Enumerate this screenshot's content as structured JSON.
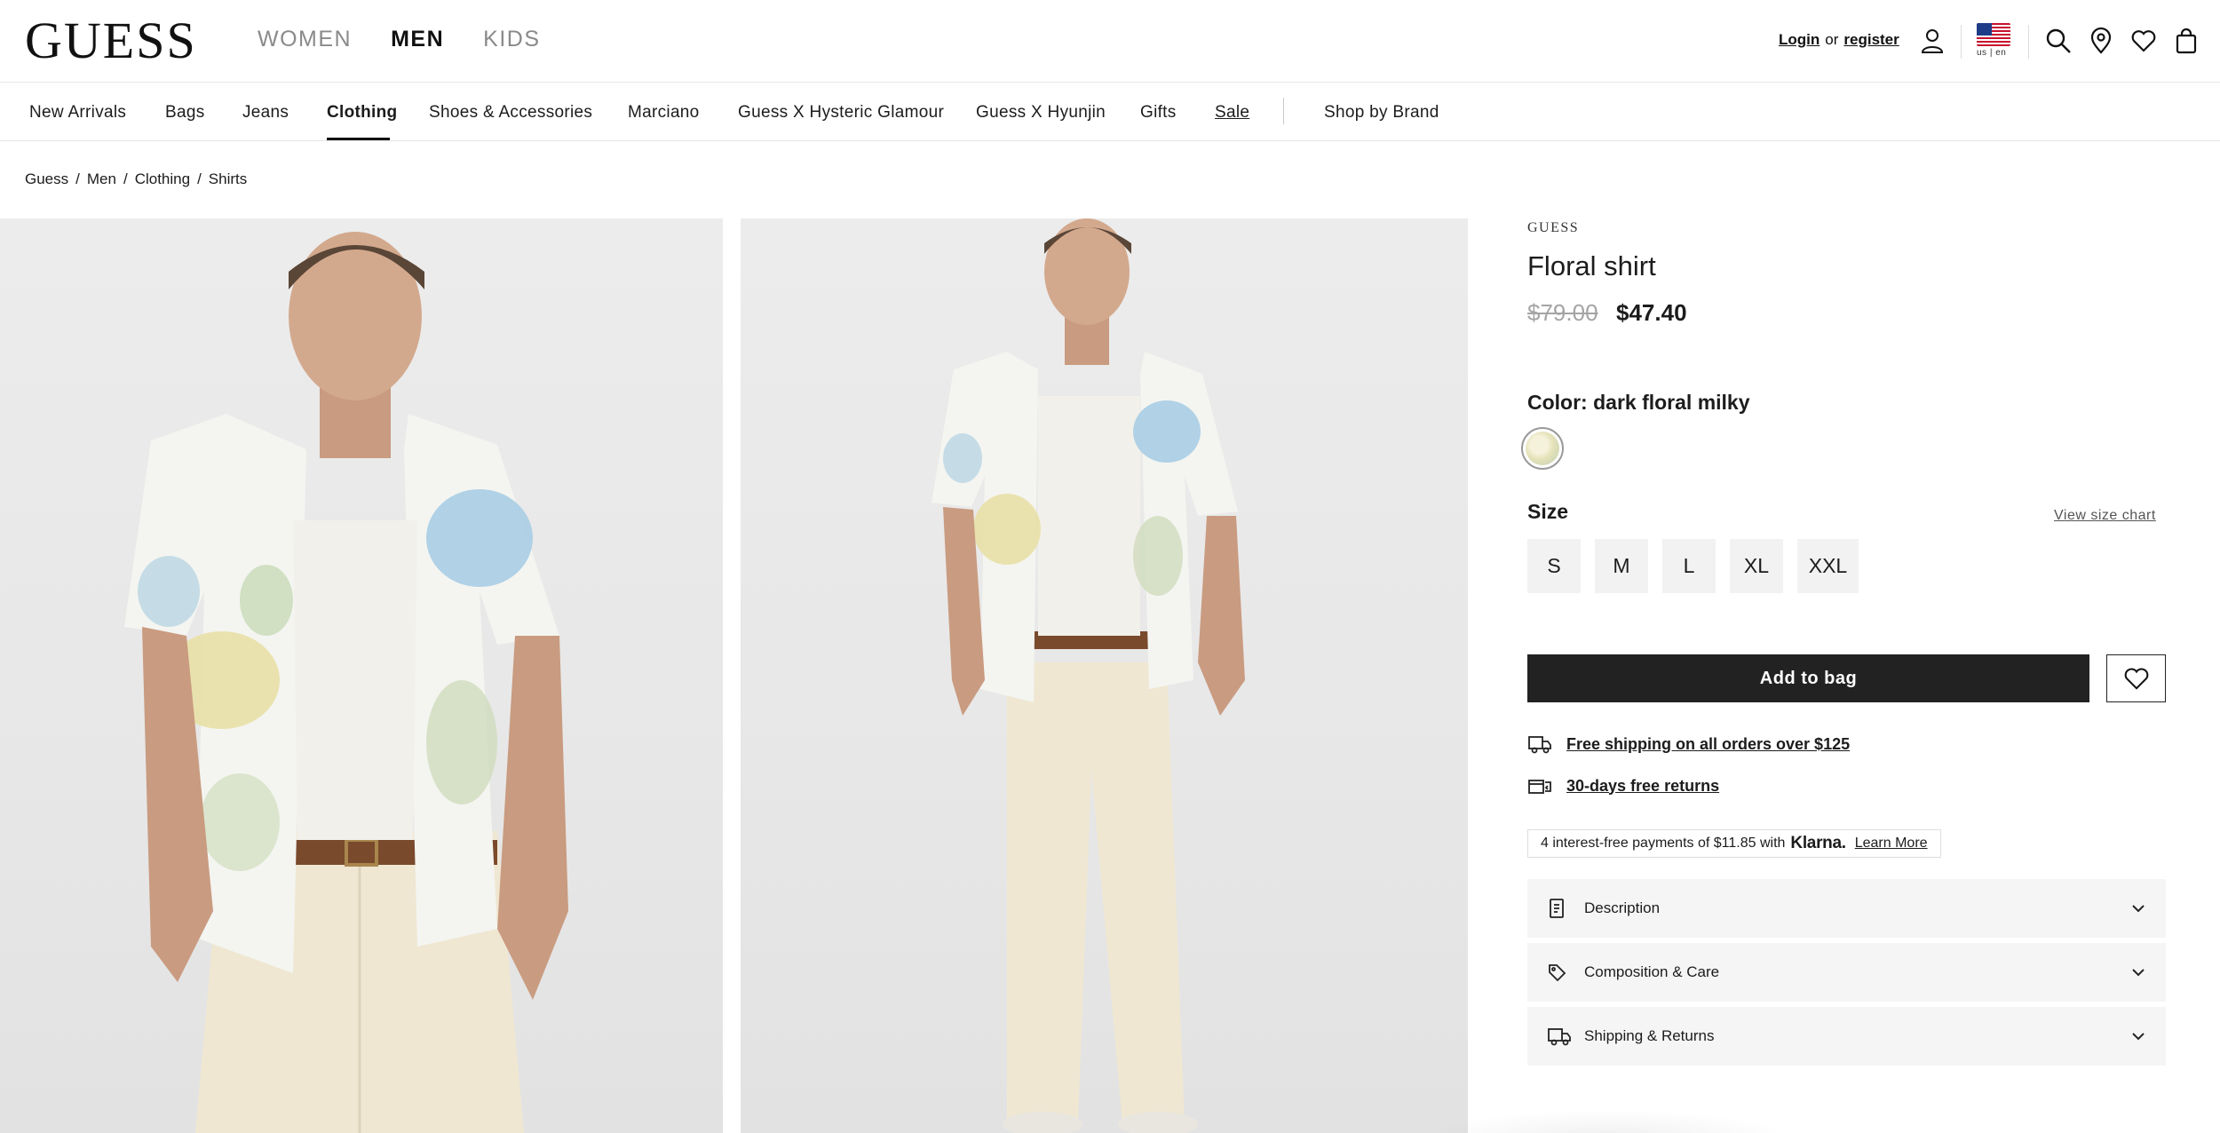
{
  "header": {
    "logo": "GUESS",
    "gender_tabs": [
      {
        "label": "WOMEN",
        "active": false
      },
      {
        "label": "MEN",
        "active": true
      },
      {
        "label": "KIDS",
        "active": false
      }
    ],
    "login_label": "Login",
    "or_label": "or",
    "register_label": "register",
    "locale_label": "us | en",
    "icons": [
      "account-icon",
      "flag-icon",
      "search-icon",
      "store-locator-icon",
      "wishlist-icon",
      "bag-icon"
    ]
  },
  "catnav": {
    "items": [
      {
        "label": "New Arrivals"
      },
      {
        "label": "Bags"
      },
      {
        "label": "Jeans"
      },
      {
        "label": "Clothing",
        "active": true
      },
      {
        "label": "Shoes & Accessories"
      },
      {
        "label": "Marciano"
      },
      {
        "label": "Guess X Hysteric Glamour"
      },
      {
        "label": "Guess X Hyunjin"
      },
      {
        "label": "Gifts"
      },
      {
        "label": "Sale"
      }
    ],
    "shop_by_brand": "Shop by Brand"
  },
  "breadcrumb": [
    "Guess",
    "Men",
    "Clothing",
    "Shirts"
  ],
  "product": {
    "brand": "GUESS",
    "title": "Floral shirt",
    "price_old": "$79.00",
    "price_new": "$47.40",
    "color_label": "Color: dark floral milky",
    "size_label": "Size",
    "size_chart_label": "View size chart",
    "sizes": [
      "S",
      "M",
      "L",
      "XL",
      "XXL"
    ],
    "add_to_bag_label": "Add to bag",
    "perks": [
      {
        "label": "Free shipping on all orders over $125",
        "icon": "truck-icon"
      },
      {
        "label": "30-days free returns",
        "icon": "returns-icon"
      }
    ],
    "klarna": {
      "text": "4 interest-free payments of $11.85 with",
      "brand": "Klarna.",
      "learn_more": "Learn More"
    },
    "accordions": [
      {
        "label": "Description",
        "icon": "document-icon"
      },
      {
        "label": "Composition & Care",
        "icon": "tag-icon"
      },
      {
        "label": "Shipping & Returns",
        "icon": "truck-icon"
      }
    ]
  },
  "colors": {
    "primary_button": "#222222",
    "accent_swatch": "#e4e2b8",
    "old_price": "#a5a5a5"
  }
}
